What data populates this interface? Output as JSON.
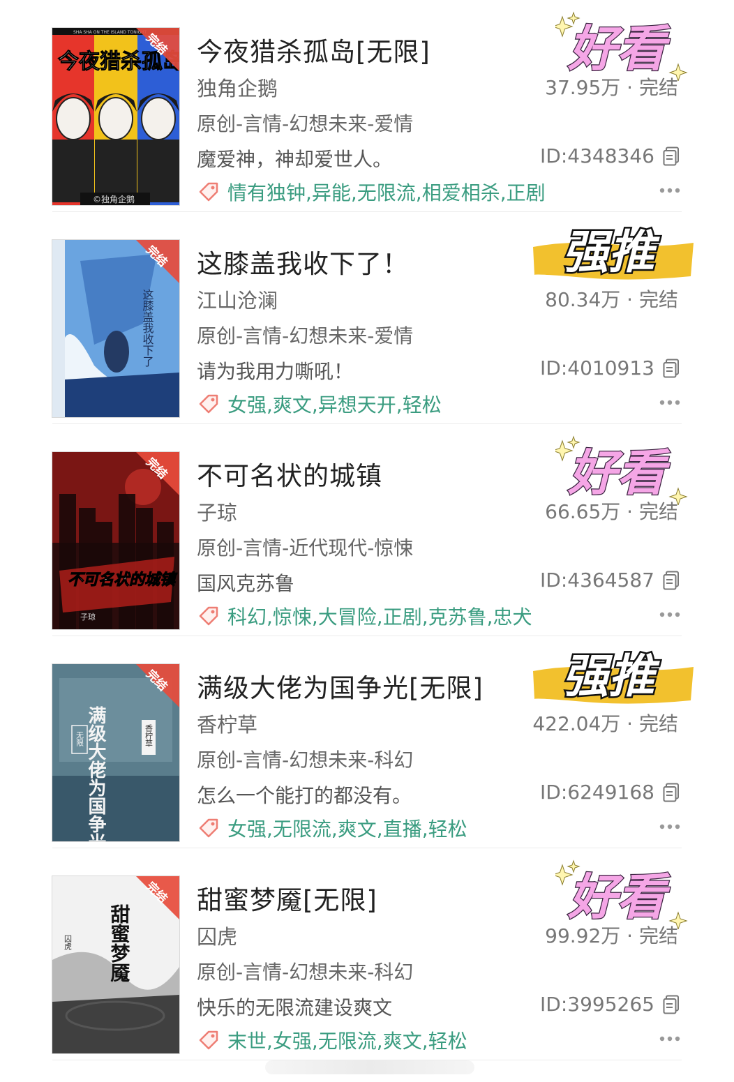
{
  "books": [
    {
      "title": "今夜猎杀孤岛[无限]",
      "author": "独角企鹅",
      "genre": "原创-言情-幻想未来-爱情",
      "desc": "魔爱神，神却爱世人。",
      "stats": "37.95万 · 完结",
      "id": "ID:4348346",
      "tags": "情有独钟,异能,无限流,相爱相杀,正剧",
      "badge": "好看",
      "badge_type": "good",
      "cover": {
        "status": "完结",
        "title": "今夜猎杀孤岛",
        "subtitle": "SHA SHA ON THE ISLAND TONIGHT",
        "author": "©独角企鹅",
        "colors": [
          "#e6352b",
          "#f2c21b",
          "#2d5ed6"
        ]
      }
    },
    {
      "title": "这膝盖我收下了！",
      "author": "江山沧澜",
      "genre": "原创-言情-幻想未来-爱情",
      "desc": "请为我用力嘶吼！",
      "stats": "80.34万 · 完结",
      "id": "ID:4010913",
      "tags": "女强,爽文,异想天开,轻松",
      "badge": "强推",
      "badge_type": "push",
      "cover": {
        "status": "完结",
        "title": "这膝盖我收下了",
        "colors": [
          "#6aa4e0",
          "#2a5fae",
          "#eef5fb"
        ]
      }
    },
    {
      "title": "不可名状的城镇",
      "author": "子琼",
      "genre": "原创-言情-近代现代-惊悚",
      "desc": "国风克苏鲁",
      "stats": "66.65万 · 完结",
      "id": "ID:4364587",
      "tags": "科幻,惊悚,大冒险,正剧,克苏鲁,忠犬",
      "badge": "好看",
      "badge_type": "good",
      "cover": {
        "status": "完结",
        "title": "不可名状的城镇",
        "author": "子琼",
        "colors": [
          "#7a1614",
          "#2b0c0c",
          "#c8322a"
        ]
      }
    },
    {
      "title": "满级大佬为国争光[无限]",
      "author": "香柠草",
      "genre": "原创-言情-幻想未来-科幻",
      "desc": "怎么一个能打的都没有。",
      "stats": "422.04万 · 完结",
      "id": "ID:6249168",
      "tags": "女强,无限流,爽文,直播,轻松",
      "badge": "强推",
      "badge_type": "push",
      "cover": {
        "status": "完结",
        "title": "满级大佬为国争光",
        "sub": "无限",
        "author": "香柠草",
        "colors": [
          "#5a7d8c",
          "#39586a",
          "#8fb0b9"
        ]
      }
    },
    {
      "title": "甜蜜梦魇[无限]",
      "author": "囚虎",
      "genre": "原创-言情-幻想未来-科幻",
      "desc": "快乐的无限流建设爽文",
      "stats": "99.92万 · 完结",
      "id": "ID:3995265",
      "tags": "末世,女强,无限流,爽文,轻松",
      "badge": "好看",
      "badge_type": "good",
      "cover": {
        "status": "完结",
        "title": "甜蜜梦魇",
        "author": "囚虎",
        "colors": [
          "#f2f2f2",
          "#888888",
          "#2a2a2a"
        ]
      }
    }
  ],
  "icons": {
    "tag": "tag-icon",
    "copy": "copy-icon",
    "more": "more-icon"
  },
  "colors": {
    "tag_text": "#3a9c80",
    "badge_good_fill": "#f5a6e6",
    "badge_push_stroke": "#f2c12e",
    "cover_corner": "#e74c3c"
  }
}
